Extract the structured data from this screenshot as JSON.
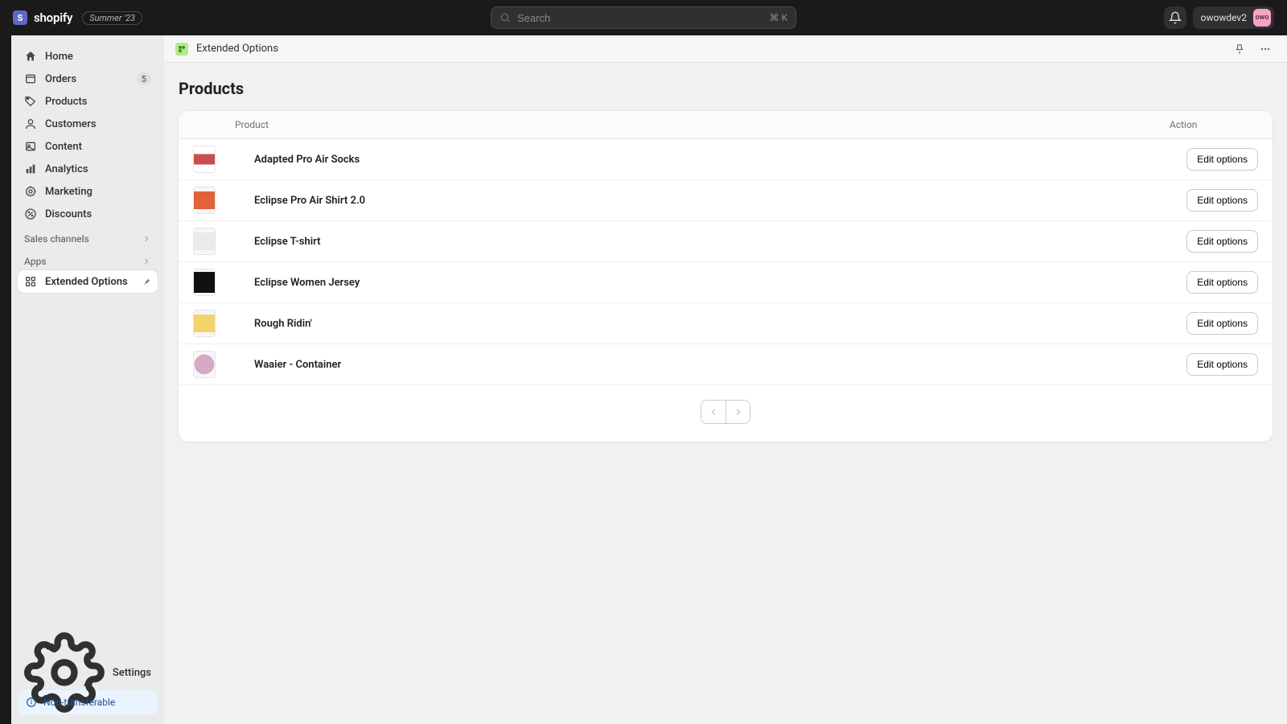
{
  "topbar": {
    "brand": "shopify",
    "badge": "Summer '23",
    "search_placeholder": "Search",
    "search_shortcut": "⌘ K",
    "user_name": "owowdev2",
    "user_initials": "owo"
  },
  "sidebar": {
    "items": [
      {
        "label": "Home"
      },
      {
        "label": "Orders",
        "badge": "5"
      },
      {
        "label": "Products"
      },
      {
        "label": "Customers"
      },
      {
        "label": "Content"
      },
      {
        "label": "Analytics"
      },
      {
        "label": "Marketing"
      },
      {
        "label": "Discounts"
      }
    ],
    "sales_channels_label": "Sales channels",
    "apps_label": "Apps",
    "app_item_label": "Extended Options",
    "settings_label": "Settings",
    "notice_label": "Non-transferable"
  },
  "app_header": {
    "title": "Extended Options"
  },
  "page": {
    "title": "Products"
  },
  "table": {
    "head_product": "Product",
    "head_action": "Action",
    "edit_label": "Edit options",
    "rows": [
      {
        "name": "Adapted Pro Air Socks"
      },
      {
        "name": "Eclipse Pro Air Shirt 2.0"
      },
      {
        "name": "Eclipse T-shirt"
      },
      {
        "name": "Eclipse Women Jersey"
      },
      {
        "name": "Rough Ridin'"
      },
      {
        "name": "Waaier - Container"
      }
    ]
  }
}
